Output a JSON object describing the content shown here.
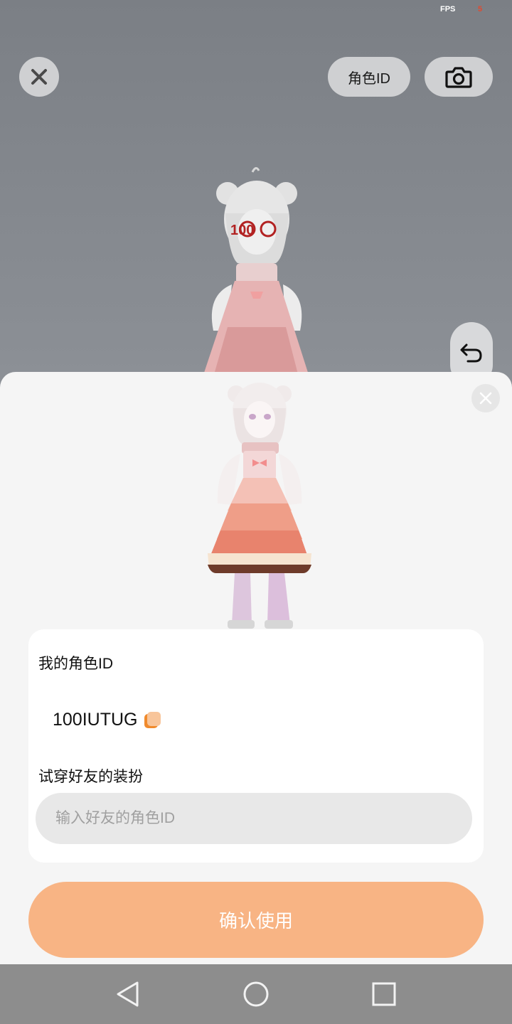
{
  "status": {
    "fps_label": "FPS",
    "fps_value": "5"
  },
  "toolbar": {
    "role_id_label": "角色ID"
  },
  "overlay": {
    "watermark": "100"
  },
  "sheet": {
    "my_id_label": "我的角色ID",
    "my_id_value": "100IUTUG",
    "try_on_label": "试穿好友的装扮",
    "friend_input_placeholder": "输入好友的角色ID",
    "confirm_label": "确认使用"
  },
  "colors": {
    "accent": "#f8b484",
    "copy_icon": "#f08a2c",
    "fps_value": "#e04a30"
  },
  "icons": {
    "close": "close-icon",
    "camera": "camera-icon",
    "undo": "undo-icon",
    "copy": "copy-icon",
    "nav_back": "triangle-back-icon",
    "nav_home": "circle-home-icon",
    "nav_recent": "square-recent-icon"
  }
}
